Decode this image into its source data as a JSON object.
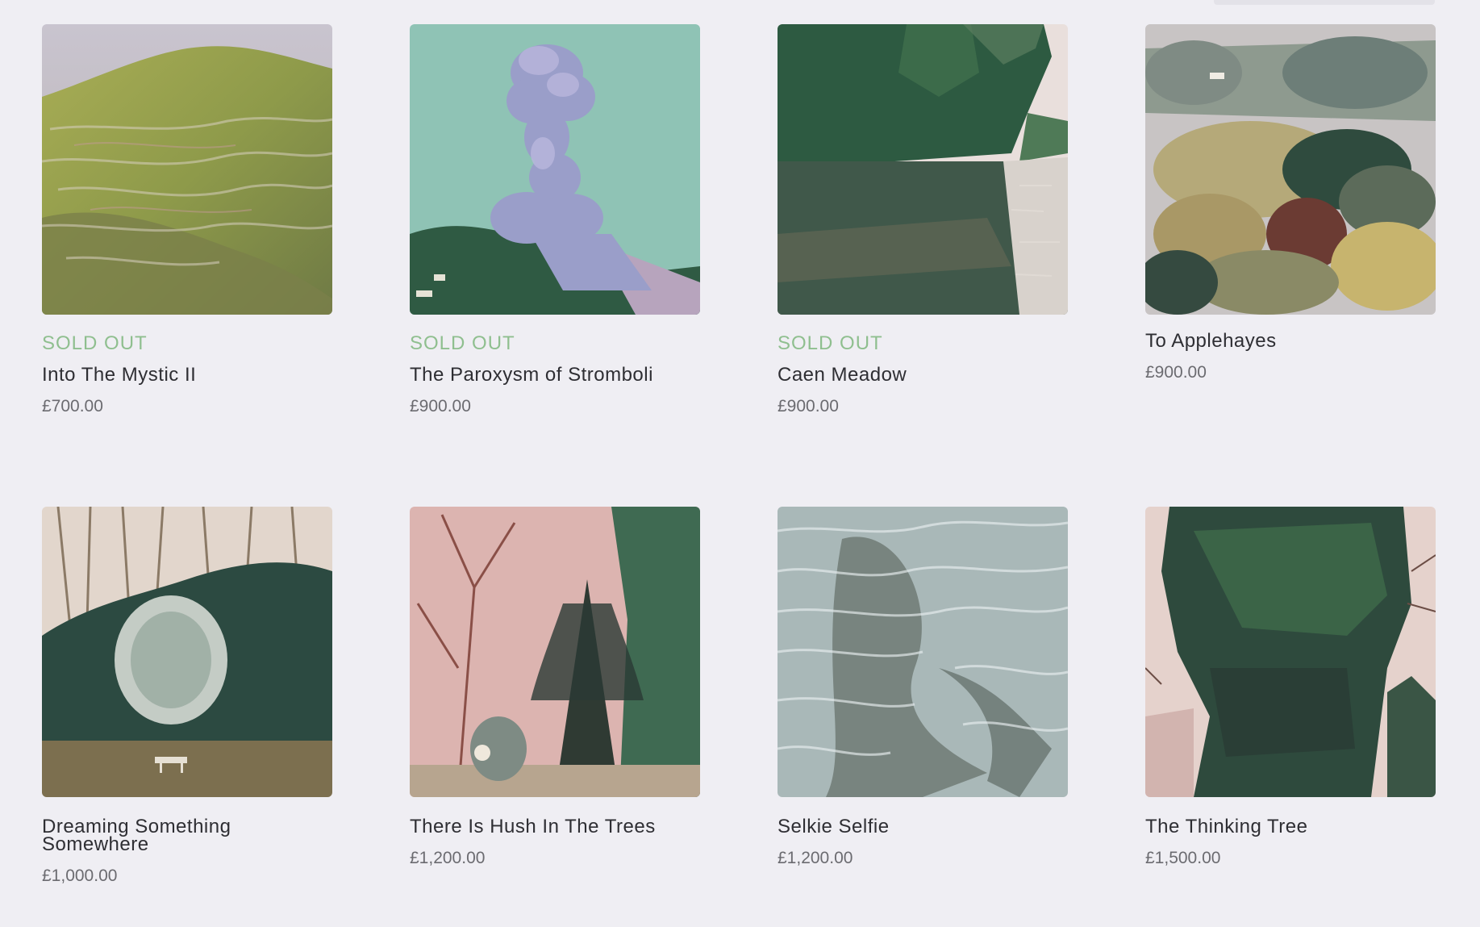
{
  "products": [
    {
      "badge": "SOLD OUT",
      "title": "Into The Mystic II",
      "price": "£700.00"
    },
    {
      "badge": "SOLD OUT",
      "title": "The Paroxysm of Stromboli",
      "price": "£900.00"
    },
    {
      "badge": "SOLD OUT",
      "title": "Caen Meadow",
      "price": "£900.00"
    },
    {
      "badge": "",
      "title": "To Applehayes",
      "price": "£900.00"
    },
    {
      "badge": "",
      "title": "Dreaming Something Somewhere",
      "price": "£1,000.00"
    },
    {
      "badge": "",
      "title": "There Is Hush In The Trees",
      "price": "£1,200.00"
    },
    {
      "badge": "",
      "title": "Selkie Selfie",
      "price": "£1,200.00"
    },
    {
      "badge": "",
      "title": "The Thinking Tree",
      "price": "£1,500.00"
    }
  ],
  "colors": {
    "background": "#efeef3",
    "sold_out": "#8fbf8f",
    "title": "#2e2e33",
    "price": "#6b6b70"
  }
}
